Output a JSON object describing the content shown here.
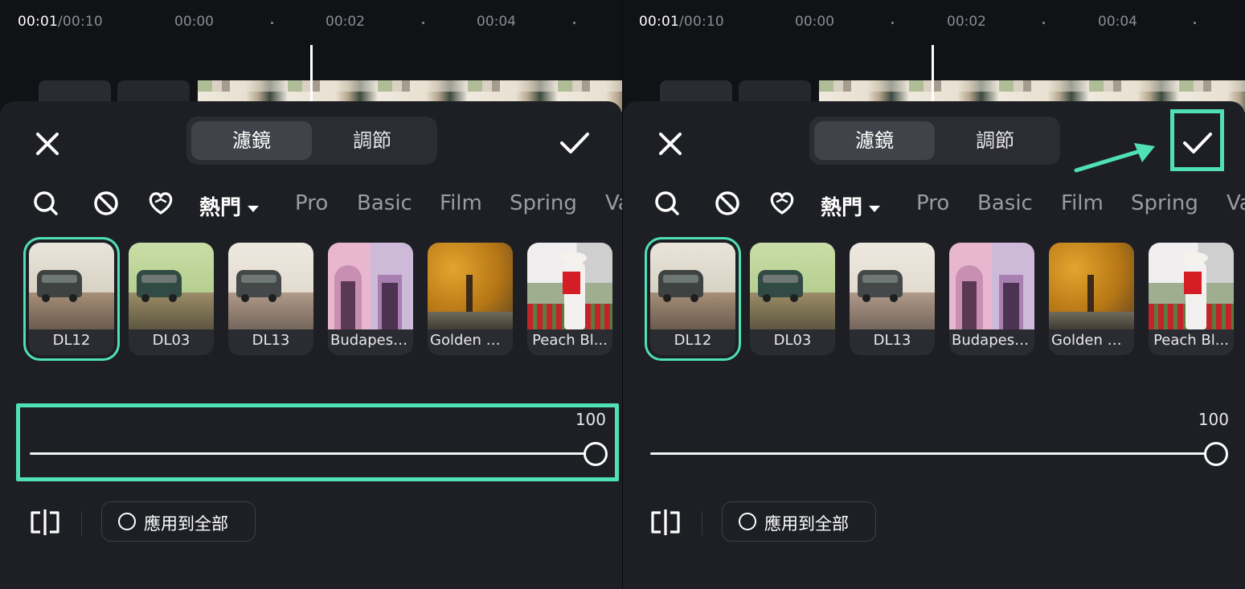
{
  "timeline": {
    "current_time": "00:01",
    "total_time": "/00:10",
    "ticks": [
      "00:00",
      "00:02",
      "00:04"
    ]
  },
  "sheet": {
    "tabs": {
      "filter": "濾鏡",
      "adjust": "調節"
    },
    "categories": {
      "hot": "熱門",
      "pro": "Pro",
      "basic": "Basic",
      "film": "Film",
      "spring": "Spring",
      "more": "Va"
    },
    "filters": [
      {
        "label": "DL12",
        "selected": true
      },
      {
        "label": "DL03"
      },
      {
        "label": "DL13"
      },
      {
        "label": "Budapest..."
      },
      {
        "label": "Golden G..."
      },
      {
        "label": "Peach Bl..."
      }
    ],
    "intensity": {
      "value": "100",
      "level": 1.0
    },
    "apply_all_label": "應用到全部"
  },
  "icons": {
    "close": "close-icon",
    "confirm": "check-icon",
    "search": "search-icon",
    "none": "no-filter-icon",
    "favorite": "heart-icon",
    "compare": "compare-icon"
  },
  "colors": {
    "accent": "#4fe0b4",
    "panel": "#1d1f24",
    "background": "#111216"
  }
}
